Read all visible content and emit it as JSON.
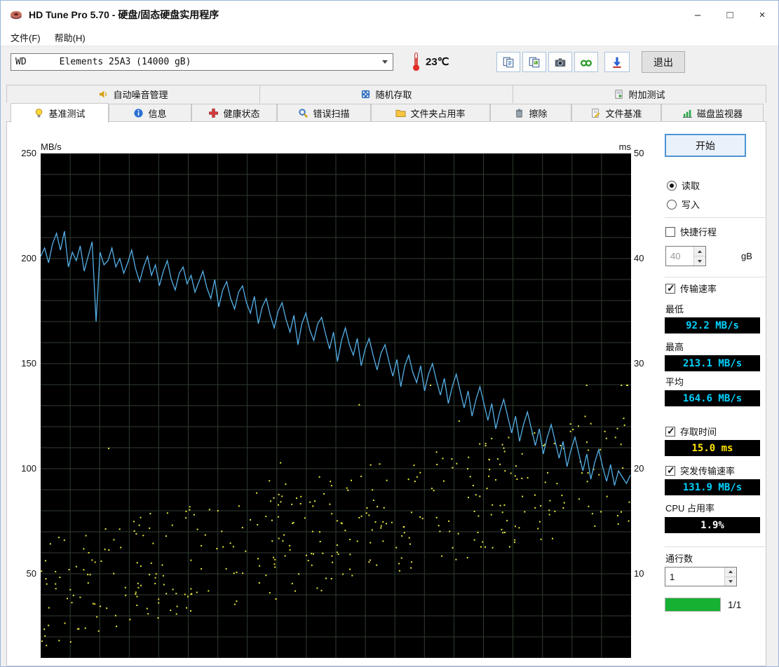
{
  "colors": {
    "transfer_line": "#55b0e8",
    "access_dots": "#e8e83c",
    "grid": "#2f3c2f",
    "chart_bg": "#000000",
    "value_cyan": "#00d2ff",
    "value_yellow": "#ffe400",
    "value_white": "#ffffff",
    "progress_green": "#16b033"
  },
  "window": {
    "title": "HD Tune Pro 5.70 - 硬盘/固态硬盘实用程序",
    "controls": {
      "minimize": "–",
      "maximize": "□",
      "close": "×"
    }
  },
  "menu": {
    "items": [
      {
        "label": "文件(F)"
      },
      {
        "label": "帮助(H)"
      }
    ]
  },
  "toolbar": {
    "drive_select": "WD      Elements 25A3 (14000 gB)",
    "temperature": "23℃",
    "exit_label": "退出"
  },
  "tabs": {
    "top": [
      {
        "label": "自动噪音管理"
      },
      {
        "label": "随机存取"
      },
      {
        "label": "附加测试"
      }
    ],
    "bottom": [
      {
        "label": "基准测试",
        "active": true
      },
      {
        "label": "信息"
      },
      {
        "label": "健康状态"
      },
      {
        "label": "错误扫描"
      },
      {
        "label": "文件夹占用率"
      },
      {
        "label": "擦除"
      },
      {
        "label": "文件基准"
      },
      {
        "label": "磁盘监视器"
      }
    ]
  },
  "side": {
    "start_label": "开始",
    "radio_read": "读取",
    "radio_write": "写入",
    "shortstroke_label": "快捷行程",
    "shortstroke_value": "40",
    "shortstroke_unit": "gB",
    "transfer_label": "传输速率",
    "min_label": "最低",
    "min_value": "92.2 MB/s",
    "max_label": "最高",
    "max_value": "213.1 MB/s",
    "avg_label": "平均",
    "avg_value": "164.6 MB/s",
    "access_label": "存取时间",
    "access_value": "15.0 ms",
    "burst_label": "突发传输速率",
    "burst_value": "131.9 MB/s",
    "cpu_label": "CPU 占用率",
    "cpu_value": "1.9%",
    "pass_label": "通行数",
    "pass_value": "1",
    "progress_text": "1/1",
    "progress_percent": 100
  },
  "chart_data": {
    "type": "line",
    "title": "HD Tune benchmark transfer rate and access time",
    "left_axis": {
      "label": "MB/s",
      "ticks": [
        250,
        200,
        150,
        100,
        50
      ],
      "min": 0,
      "max": 250
    },
    "right_axis": {
      "label": "ms",
      "ticks": [
        50,
        40,
        30,
        20,
        10
      ],
      "min": 0,
      "max": 50
    },
    "grid": true,
    "legend_position": "none",
    "summary": {
      "min_mb_s": 92.2,
      "max_mb_s": 213.1,
      "avg_mb_s": 164.6,
      "access_time_ms": 15.0,
      "burst_mb_s": 131.9,
      "cpu_pct": 1.9
    },
    "series": [
      {
        "name": "transfer_rate",
        "unit": "MB/s",
        "axis": "left",
        "color": "#55b0e8",
        "values": [
          201,
          205,
          198,
          207,
          212,
          204,
          213,
          196,
          203,
          199,
          206,
          194,
          201,
          208,
          170,
          203,
          197,
          199,
          205,
          196,
          200,
          193,
          198,
          204,
          195,
          189,
          196,
          201,
          192,
          197,
          187,
          194,
          199,
          190,
          185,
          193,
          196,
          188,
          192,
          184,
          189,
          194,
          186,
          181,
          190,
          177,
          185,
          189,
          181,
          176,
          184,
          187,
          179,
          174,
          182,
          169,
          177,
          181,
          173,
          167,
          175,
          179,
          171,
          165,
          173,
          159,
          169,
          174,
          166,
          161,
          169,
          172,
          164,
          157,
          165,
          151,
          161,
          167,
          159,
          154,
          162,
          149,
          157,
          162,
          154,
          147,
          155,
          159,
          151,
          144,
          152,
          139,
          149,
          154,
          146,
          141,
          149,
          137,
          145,
          150,
          142,
          135,
          143,
          131,
          139,
          145,
          137,
          129,
          137,
          125,
          133,
          139,
          131,
          123,
          131,
          119,
          127,
          133,
          125,
          117,
          125,
          113,
          121,
          127,
          119,
          111,
          119,
          107,
          115,
          121,
          113,
          105,
          113,
          101,
          109,
          115,
          107,
          99,
          107,
          95,
          103,
          109,
          101,
          94,
          102,
          92,
          99,
          96,
          93,
          97
        ]
      },
      {
        "name": "access_time",
        "unit": "ms",
        "axis": "right",
        "type": "scatter",
        "color": "#e8e83c",
        "generator": {
          "seed": 20240501,
          "count": 400,
          "ms_base_start": 2.5,
          "ms_base_end": 15,
          "ms_spread": 11,
          "outlier_chance": 0.05,
          "outlier_extra": 9,
          "ms_min": 1.5,
          "ms_max": 28
        }
      }
    ]
  }
}
